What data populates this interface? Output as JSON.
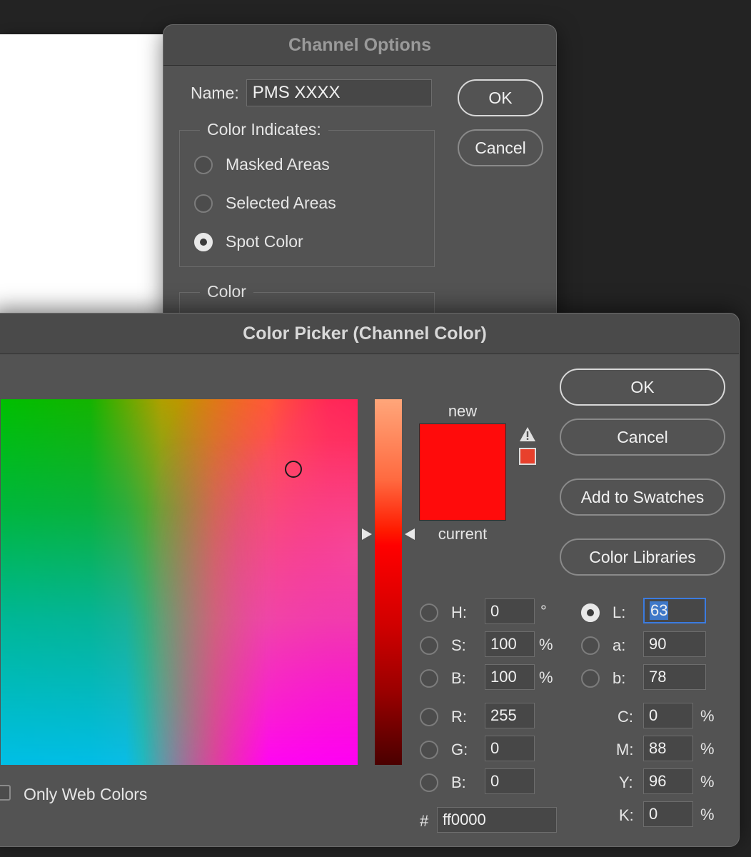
{
  "channel_options": {
    "title": "Channel Options",
    "name_label": "Name:",
    "name_value": "PMS XXXX",
    "ok_label": "OK",
    "cancel_label": "Cancel",
    "color_indicates_label": "Color Indicates:",
    "options": [
      {
        "label": "Masked Areas",
        "checked": false
      },
      {
        "label": "Selected Areas",
        "checked": false
      },
      {
        "label": "Spot Color",
        "checked": true
      }
    ],
    "color_group_label": "Color"
  },
  "color_picker": {
    "title": "Color Picker (Channel Color)",
    "ok_label": "OK",
    "cancel_label": "Cancel",
    "add_swatches_label": "Add to Swatches",
    "color_libraries_label": "Color Libraries",
    "new_label": "new",
    "current_label": "current",
    "new_color": "#ff0b0b",
    "current_color": "#ff0b0b",
    "gamut_color": "#e8402c",
    "warning_icon": "gamut-warning-icon",
    "hsb": {
      "h_label": "H:",
      "h_value": "0",
      "h_unit": "°",
      "s_label": "S:",
      "s_value": "100",
      "s_unit": "%",
      "b_label": "B:",
      "b_value": "100",
      "b_unit": "%"
    },
    "rgb": {
      "r_label": "R:",
      "r_value": "255",
      "g_label": "G:",
      "g_value": "0",
      "b_label": "B:",
      "b_value": "0"
    },
    "lab": {
      "l_label": "L:",
      "l_value": "63",
      "a_label": "a:",
      "a_value": "90",
      "b_label": "b:",
      "b_value": "78"
    },
    "cmyk": {
      "c_label": "C:",
      "c_value": "0",
      "m_label": "M:",
      "m_value": "88",
      "y_label": "Y:",
      "y_value": "96",
      "k_label": "K:",
      "k_value": "0",
      "unit": "%"
    },
    "hex_label": "#",
    "hex_value": "ff0000",
    "web_colors_label": "Only Web Colors"
  }
}
